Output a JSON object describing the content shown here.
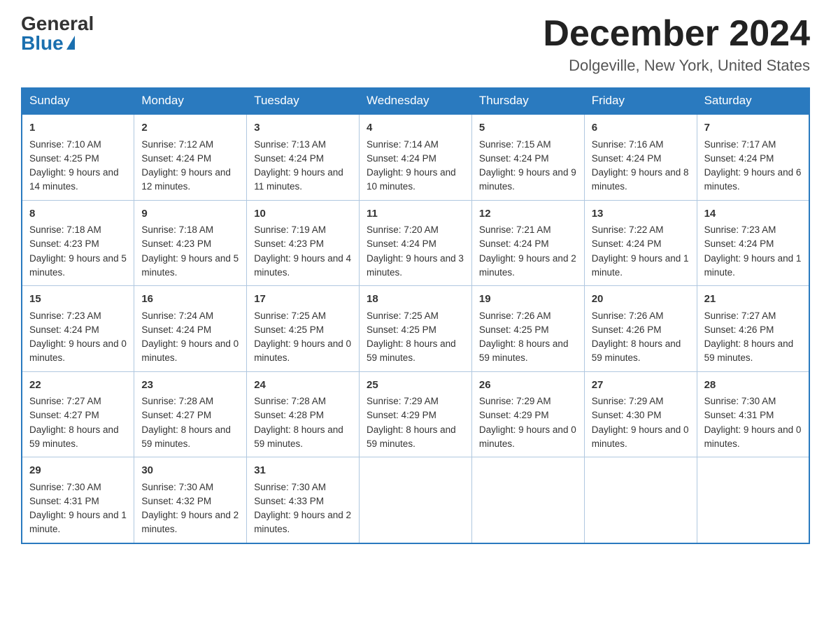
{
  "header": {
    "logo_general": "General",
    "logo_blue": "Blue",
    "month_title": "December 2024",
    "location": "Dolgeville, New York, United States"
  },
  "weekdays": [
    "Sunday",
    "Monday",
    "Tuesday",
    "Wednesday",
    "Thursday",
    "Friday",
    "Saturday"
  ],
  "weeks": [
    [
      {
        "day": "1",
        "sunrise": "Sunrise: 7:10 AM",
        "sunset": "Sunset: 4:25 PM",
        "daylight": "Daylight: 9 hours and 14 minutes."
      },
      {
        "day": "2",
        "sunrise": "Sunrise: 7:12 AM",
        "sunset": "Sunset: 4:24 PM",
        "daylight": "Daylight: 9 hours and 12 minutes."
      },
      {
        "day": "3",
        "sunrise": "Sunrise: 7:13 AM",
        "sunset": "Sunset: 4:24 PM",
        "daylight": "Daylight: 9 hours and 11 minutes."
      },
      {
        "day": "4",
        "sunrise": "Sunrise: 7:14 AM",
        "sunset": "Sunset: 4:24 PM",
        "daylight": "Daylight: 9 hours and 10 minutes."
      },
      {
        "day": "5",
        "sunrise": "Sunrise: 7:15 AM",
        "sunset": "Sunset: 4:24 PM",
        "daylight": "Daylight: 9 hours and 9 minutes."
      },
      {
        "day": "6",
        "sunrise": "Sunrise: 7:16 AM",
        "sunset": "Sunset: 4:24 PM",
        "daylight": "Daylight: 9 hours and 8 minutes."
      },
      {
        "day": "7",
        "sunrise": "Sunrise: 7:17 AM",
        "sunset": "Sunset: 4:24 PM",
        "daylight": "Daylight: 9 hours and 6 minutes."
      }
    ],
    [
      {
        "day": "8",
        "sunrise": "Sunrise: 7:18 AM",
        "sunset": "Sunset: 4:23 PM",
        "daylight": "Daylight: 9 hours and 5 minutes."
      },
      {
        "day": "9",
        "sunrise": "Sunrise: 7:18 AM",
        "sunset": "Sunset: 4:23 PM",
        "daylight": "Daylight: 9 hours and 5 minutes."
      },
      {
        "day": "10",
        "sunrise": "Sunrise: 7:19 AM",
        "sunset": "Sunset: 4:23 PM",
        "daylight": "Daylight: 9 hours and 4 minutes."
      },
      {
        "day": "11",
        "sunrise": "Sunrise: 7:20 AM",
        "sunset": "Sunset: 4:24 PM",
        "daylight": "Daylight: 9 hours and 3 minutes."
      },
      {
        "day": "12",
        "sunrise": "Sunrise: 7:21 AM",
        "sunset": "Sunset: 4:24 PM",
        "daylight": "Daylight: 9 hours and 2 minutes."
      },
      {
        "day": "13",
        "sunrise": "Sunrise: 7:22 AM",
        "sunset": "Sunset: 4:24 PM",
        "daylight": "Daylight: 9 hours and 1 minute."
      },
      {
        "day": "14",
        "sunrise": "Sunrise: 7:23 AM",
        "sunset": "Sunset: 4:24 PM",
        "daylight": "Daylight: 9 hours and 1 minute."
      }
    ],
    [
      {
        "day": "15",
        "sunrise": "Sunrise: 7:23 AM",
        "sunset": "Sunset: 4:24 PM",
        "daylight": "Daylight: 9 hours and 0 minutes."
      },
      {
        "day": "16",
        "sunrise": "Sunrise: 7:24 AM",
        "sunset": "Sunset: 4:24 PM",
        "daylight": "Daylight: 9 hours and 0 minutes."
      },
      {
        "day": "17",
        "sunrise": "Sunrise: 7:25 AM",
        "sunset": "Sunset: 4:25 PM",
        "daylight": "Daylight: 9 hours and 0 minutes."
      },
      {
        "day": "18",
        "sunrise": "Sunrise: 7:25 AM",
        "sunset": "Sunset: 4:25 PM",
        "daylight": "Daylight: 8 hours and 59 minutes."
      },
      {
        "day": "19",
        "sunrise": "Sunrise: 7:26 AM",
        "sunset": "Sunset: 4:25 PM",
        "daylight": "Daylight: 8 hours and 59 minutes."
      },
      {
        "day": "20",
        "sunrise": "Sunrise: 7:26 AM",
        "sunset": "Sunset: 4:26 PM",
        "daylight": "Daylight: 8 hours and 59 minutes."
      },
      {
        "day": "21",
        "sunrise": "Sunrise: 7:27 AM",
        "sunset": "Sunset: 4:26 PM",
        "daylight": "Daylight: 8 hours and 59 minutes."
      }
    ],
    [
      {
        "day": "22",
        "sunrise": "Sunrise: 7:27 AM",
        "sunset": "Sunset: 4:27 PM",
        "daylight": "Daylight: 8 hours and 59 minutes."
      },
      {
        "day": "23",
        "sunrise": "Sunrise: 7:28 AM",
        "sunset": "Sunset: 4:27 PM",
        "daylight": "Daylight: 8 hours and 59 minutes."
      },
      {
        "day": "24",
        "sunrise": "Sunrise: 7:28 AM",
        "sunset": "Sunset: 4:28 PM",
        "daylight": "Daylight: 8 hours and 59 minutes."
      },
      {
        "day": "25",
        "sunrise": "Sunrise: 7:29 AM",
        "sunset": "Sunset: 4:29 PM",
        "daylight": "Daylight: 8 hours and 59 minutes."
      },
      {
        "day": "26",
        "sunrise": "Sunrise: 7:29 AM",
        "sunset": "Sunset: 4:29 PM",
        "daylight": "Daylight: 9 hours and 0 minutes."
      },
      {
        "day": "27",
        "sunrise": "Sunrise: 7:29 AM",
        "sunset": "Sunset: 4:30 PM",
        "daylight": "Daylight: 9 hours and 0 minutes."
      },
      {
        "day": "28",
        "sunrise": "Sunrise: 7:30 AM",
        "sunset": "Sunset: 4:31 PM",
        "daylight": "Daylight: 9 hours and 0 minutes."
      }
    ],
    [
      {
        "day": "29",
        "sunrise": "Sunrise: 7:30 AM",
        "sunset": "Sunset: 4:31 PM",
        "daylight": "Daylight: 9 hours and 1 minute."
      },
      {
        "day": "30",
        "sunrise": "Sunrise: 7:30 AM",
        "sunset": "Sunset: 4:32 PM",
        "daylight": "Daylight: 9 hours and 2 minutes."
      },
      {
        "day": "31",
        "sunrise": "Sunrise: 7:30 AM",
        "sunset": "Sunset: 4:33 PM",
        "daylight": "Daylight: 9 hours and 2 minutes."
      },
      null,
      null,
      null,
      null
    ]
  ]
}
